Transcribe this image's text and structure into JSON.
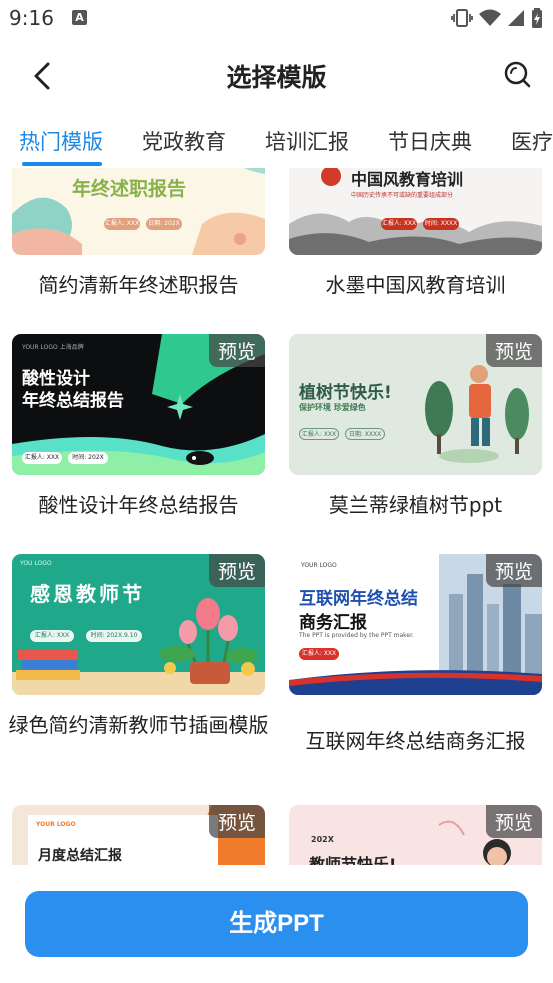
{
  "status_bar": {
    "time": "9:16",
    "notification_letter": "A",
    "icons": [
      "vibrate-icon",
      "wifi-icon",
      "signal-icon",
      "battery-icon"
    ]
  },
  "app_bar": {
    "title": "选择模版",
    "back_icon": "back-arrow-icon",
    "search_icon": "search-icon"
  },
  "tabs": [
    {
      "label": "热门模版",
      "active": true
    },
    {
      "label": "党政教育",
      "active": false
    },
    {
      "label": "培训汇报",
      "active": false
    },
    {
      "label": "节日庆典",
      "active": false
    },
    {
      "label": "医疗",
      "active": false
    }
  ],
  "preview_label": "预览",
  "templates": [
    {
      "title": "简约清新年终述职报告",
      "thumb_text": {
        "heading": "年终述职报告",
        "pill1": "汇报人: XXX",
        "pill2": "日期: 202X"
      }
    },
    {
      "title": "水墨中国风教育培训",
      "thumb_text": {
        "heading": "中国风教育培训",
        "sub": "中国历史传承不可或缺的重要组成部分",
        "pill1": "汇报人: XXX",
        "pill2": "时间: XXXX"
      }
    },
    {
      "title": "酸性设计年终总结报告",
      "thumb_text": {
        "heading1": "酸性设计",
        "heading2": "年终总结报告",
        "logo": "YOUR LOGO 上海品牌",
        "pill1": "汇报人: XXX",
        "pill2": "时间: 202X"
      }
    },
    {
      "title": "莫兰蒂绿植树节ppt",
      "thumb_text": {
        "heading": "植树节快乐!",
        "sub": "保护环境 珍爱绿色",
        "pill1": "汇报人: XXX",
        "pill2": "日期: XXXX"
      }
    },
    {
      "title": "绿色简约清新教师节插画模版",
      "thumb_text": {
        "logo": "YOU LOGO",
        "heading": "感恩教师节",
        "pill1": "汇报人: XXX",
        "pill2": "时间: 202X.9.10"
      }
    },
    {
      "title": "互联网年终总结商务汇报",
      "thumb_text": {
        "logo": "YOUR LOGO",
        "heading1": "互联网年终总结",
        "heading2": "商务汇报",
        "sub": "The PPT is provided by the PPT maker.",
        "pill1": "汇报人: XXX"
      }
    },
    {
      "title": "",
      "thumb_text": {
        "logo": "YOUR LOGO",
        "heading": "月度总结汇报"
      }
    },
    {
      "title": "",
      "thumb_text": {
        "logo": "202X",
        "heading": "教师节快乐!"
      }
    }
  ],
  "generate_button": {
    "label": "生成PPT"
  },
  "colors": {
    "accent": "#1E88E5",
    "button": "#2b8ff0"
  }
}
